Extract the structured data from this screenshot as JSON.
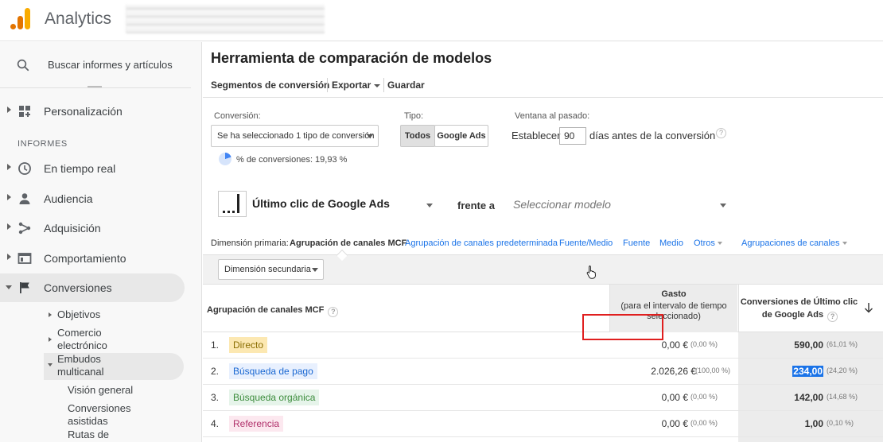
{
  "header": {
    "app_title": "Analytics",
    "logo_colors": [
      "#e37400",
      "#f9ab00"
    ]
  },
  "sidebar": {
    "search_placeholder": "Buscar informes y artículos",
    "personalization": "Personalización",
    "section_reports": "INFORMES",
    "items": [
      {
        "label": "En tiempo real",
        "icon": "clock-icon"
      },
      {
        "label": "Audiencia",
        "icon": "person-icon"
      },
      {
        "label": "Adquisición",
        "icon": "acquisition-icon"
      },
      {
        "label": "Comportamiento",
        "icon": "behavior-icon"
      },
      {
        "label": "Conversiones",
        "icon": "flag-icon"
      }
    ],
    "conversions_sub": {
      "objetivos": "Objetivos",
      "comercio_1": "Comercio",
      "comercio_2": "electrónico",
      "embudos_1": "Embudos",
      "embudos_2": "multicanal",
      "leaf_vision": "Visión general",
      "leaf_asistidas_1": "Conversiones",
      "leaf_asistidas_2": "asistidas",
      "leaf_rutas": "Rutas de"
    }
  },
  "main": {
    "title": "Herramienta de comparación de modelos",
    "toolbar": {
      "segments": "Segmentos de conversión",
      "export": "Exportar",
      "save": "Guardar"
    },
    "conversion": {
      "label": "Conversión:",
      "selected": "Se ha seleccionado 1 tipo de conversión",
      "percent_text": "% de conversiones: 19,93 %",
      "percent_value": 0.1993
    },
    "type": {
      "label": "Tipo:",
      "all": "Todos",
      "google_ads": "Google Ads"
    },
    "lookback": {
      "label": "Ventana al pasado:",
      "prefix": "Establecer",
      "days": "90",
      "suffix": "días antes de la conversión"
    },
    "model": {
      "name": "Último clic de Google Ads",
      "versus": "frente a",
      "placeholder": "Seleccionar modelo"
    },
    "dimensions": {
      "label": "Dimensión primaria:",
      "current": "Agrupación de canales MCF",
      "links": [
        "Agrupación de canales predeterminada",
        "Fuente/Medio",
        "Fuente",
        "Medio"
      ],
      "others": "Otros",
      "channel_groups": "Agrupaciones de canales"
    },
    "secondary_dimension": "Dimensión secundaria",
    "table": {
      "col1": "Agrupación de canales MCF",
      "col2_title": "Gasto",
      "col2_sub": "(para el intervalo de tiempo seleccionado)",
      "col3_line1": "Conversiones de Último clic",
      "col3_line2": "de Google Ads",
      "rows": [
        {
          "num": "1.",
          "channel": "Directo",
          "spend": "0,00 €",
          "spend_pct": "(0,00 %)",
          "conv": "590,00",
          "conv_pct": "(61,01 %)",
          "bg": "#fce8b2",
          "fg": "#8a6d00"
        },
        {
          "num": "2.",
          "channel": "Búsqueda de pago",
          "spend": "2.026,26 €",
          "spend_pct": "(100,00 %)",
          "conv": "234,00",
          "conv_pct": "(24,20 %)",
          "bg": "#e8f0fe",
          "fg": "#1967d2"
        },
        {
          "num": "3.",
          "channel": "Búsqueda orgánica",
          "spend": "0,00 €",
          "spend_pct": "(0,00 %)",
          "conv": "142,00",
          "conv_pct": "(14,68 %)",
          "bg": "#e6f4ea",
          "fg": "#3c8c3c"
        },
        {
          "num": "4.",
          "channel": "Referencia",
          "spend": "0,00 €",
          "spend_pct": "(0,00 %)",
          "conv": "1,00",
          "conv_pct": "(0,10 %)",
          "bg": "#fce8ef",
          "fg": "#b0306a"
        }
      ]
    },
    "highlight_color": "#e01f1f"
  }
}
